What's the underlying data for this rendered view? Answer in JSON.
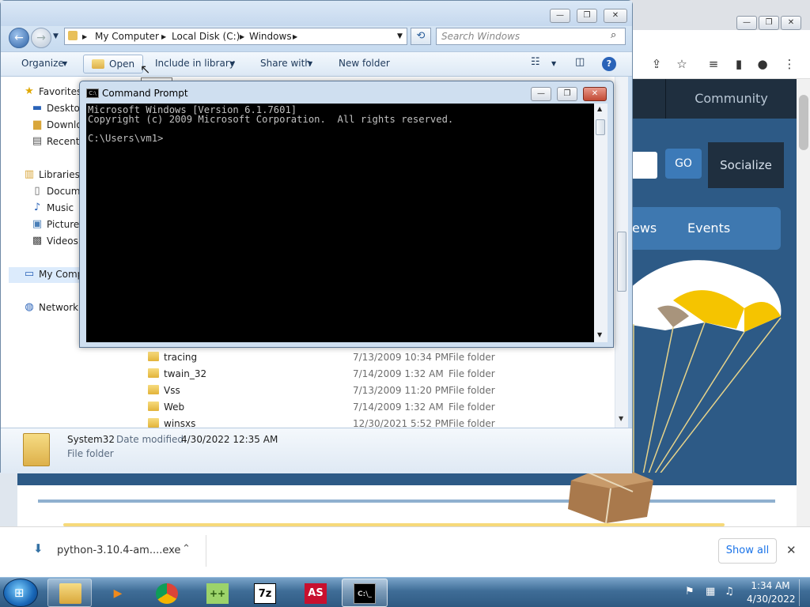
{
  "explorer": {
    "breadcrumb": [
      "My Computer",
      "Local Disk (C:)",
      "Windows"
    ],
    "search_placeholder": "Search Windows",
    "toolbar": {
      "organize": "Organize",
      "open": "Open",
      "include_in_library": "Include in library",
      "share_with": "Share with",
      "new_folder": "New folder"
    },
    "tooltip": "Open",
    "sidebar": {
      "favorites": "Favorites",
      "desktop": "Desktop",
      "downloads": "Downlo",
      "recent": "Recent",
      "libraries": "Libraries",
      "documents": "Docume",
      "music": "Music",
      "pictures": "Pictures",
      "videos": "Videos",
      "my_computer": "My Comp",
      "network": "Network"
    },
    "files": [
      {
        "name": "tracing",
        "date": "7/13/2009 10:34 PM",
        "type": "File folder"
      },
      {
        "name": "twain_32",
        "date": "7/14/2009 1:32 AM",
        "type": "File folder"
      },
      {
        "name": "Vss",
        "date": "7/13/2009 11:20 PM",
        "type": "File folder"
      },
      {
        "name": "Web",
        "date": "7/14/2009 1:32 AM",
        "type": "File folder"
      },
      {
        "name": "winsxs",
        "date": "12/30/2021 5:52 PM",
        "type": "File folder"
      }
    ],
    "details": {
      "name": "System32",
      "date_label": "Date modified:",
      "date": "4/30/2022 12:35 AM",
      "type": "File folder"
    }
  },
  "cmd": {
    "title": "Command Prompt",
    "lines": [
      "Microsoft Windows [Version 6.1.7601]",
      "Copyright (c) 2009 Microsoft Corporation.  All rights reserved.",
      "",
      "C:\\Users\\vm1>"
    ]
  },
  "browser": {
    "community": "Community",
    "go": "GO",
    "socialize": "Socialize",
    "news": "ews",
    "events": "Events"
  },
  "download_bar": {
    "filename": "python-3.10.4-am....exe",
    "show_all": "Show all"
  },
  "taskbar": {
    "time": "1:34 AM",
    "date": "4/30/2022",
    "apps": [
      "file-explorer",
      "media-player",
      "chrome",
      "notepad-plus-plus",
      "7-zip",
      "anime-studio",
      "command-prompt"
    ]
  }
}
